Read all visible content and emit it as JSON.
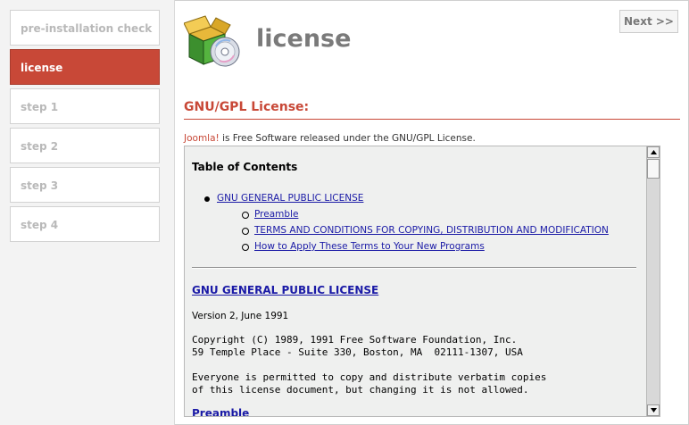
{
  "sidebar": {
    "steps": [
      {
        "label": "pre-installation check",
        "active": false
      },
      {
        "label": "license",
        "active": true
      },
      {
        "label": "step 1",
        "active": false
      },
      {
        "label": "step 2",
        "active": false
      },
      {
        "label": "step 3",
        "active": false
      },
      {
        "label": "step 4",
        "active": false
      }
    ]
  },
  "header": {
    "title": "license",
    "next_label": "Next >>"
  },
  "section": {
    "title": "GNU/GPL License:",
    "intro_brand": "Joomla!",
    "intro_text": " is Free Software released under the GNU/GPL License."
  },
  "license": {
    "toc_title": "Table of Contents",
    "toc_main": "GNU GENERAL PUBLIC LICENSE",
    "toc_sub": [
      "Preamble",
      "TERMS AND CONDITIONS FOR COPYING, DISTRIBUTION AND MODIFICATION",
      "How to Apply These Terms to Your New Programs"
    ],
    "heading": "GNU GENERAL PUBLIC LICENSE",
    "version": "Version 2, June 1991",
    "copyright_1": "Copyright (C) 1989, 1991 Free Software Foundation, Inc.",
    "copyright_2": "59 Temple Place - Suite 330, Boston, MA  02111-1307, USA",
    "perm_1": "Everyone is permitted to copy and distribute verbatim copies",
    "perm_2": "of this license document, but changing it is not allowed.",
    "preamble_heading": "Preamble"
  },
  "colors": {
    "accent": "#c84837",
    "link": "#1a1aa6"
  }
}
